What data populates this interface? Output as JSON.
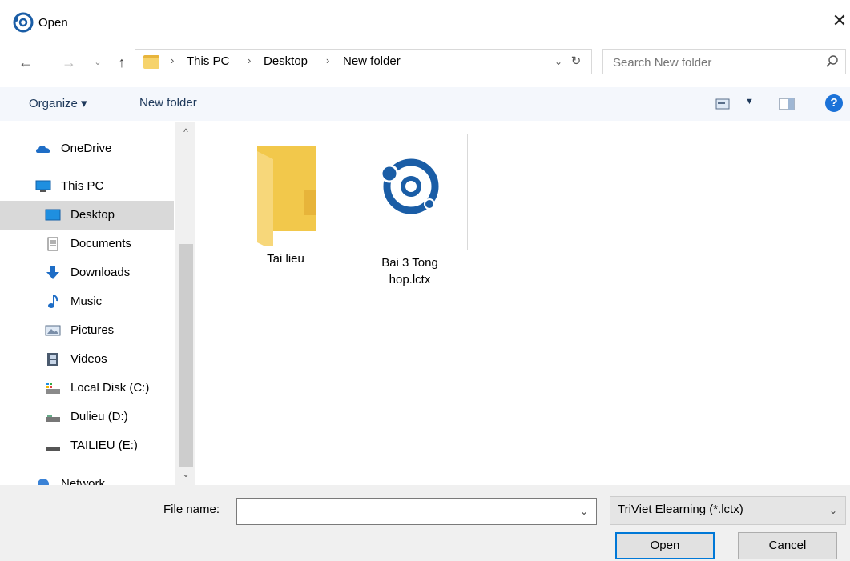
{
  "window": {
    "title": "Open",
    "close_icon": "close-icon"
  },
  "address": {
    "breadcrumbs": [
      "This PC",
      "Desktop",
      "New folder"
    ],
    "separator": "›"
  },
  "search": {
    "placeholder": "Search New folder"
  },
  "toolbar": {
    "organize_label": "Organize ▾",
    "new_folder_label": "New folder",
    "help_label": "?"
  },
  "nav": {
    "items": [
      {
        "label": "OneDrive",
        "icon": "onedrive-icon"
      },
      {
        "label": "This PC",
        "icon": "computer-icon"
      },
      {
        "label": "Desktop",
        "icon": "desktop-icon",
        "selected": true
      },
      {
        "label": "Documents",
        "icon": "documents-icon"
      },
      {
        "label": "Downloads",
        "icon": "downloads-icon"
      },
      {
        "label": "Music",
        "icon": "music-icon"
      },
      {
        "label": "Pictures",
        "icon": "pictures-icon"
      },
      {
        "label": "Videos",
        "icon": "videos-icon"
      },
      {
        "label": "Local Disk (C:)",
        "icon": "local-disk-icon"
      },
      {
        "label": "Dulieu (D:)",
        "icon": "drive-icon"
      },
      {
        "label": "TAILIEU (E:)",
        "icon": "drive-icon"
      },
      {
        "label": "Network",
        "icon": "network-icon"
      }
    ]
  },
  "files": [
    {
      "label": "Tai lieu",
      "icon": "folder-icon"
    },
    {
      "label_line1": "Bai 3 Tong",
      "label_line2": "hop.lctx",
      "icon": "elearning-file-icon"
    }
  ],
  "bottom": {
    "file_name_label": "File name:",
    "file_name_value": "",
    "filter_label": "TriViet Elearning (*.lctx)",
    "open_label": "Open",
    "cancel_label": "Cancel"
  },
  "colors": {
    "accent": "#0078d7",
    "logo_blue": "#1a5da6",
    "selected_bg": "#d9d9d9"
  }
}
